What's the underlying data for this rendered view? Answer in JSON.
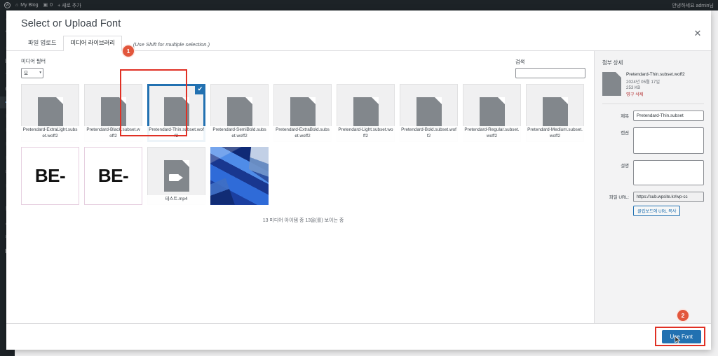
{
  "adminbar": {
    "logo_icon": "wordpress-logo-icon",
    "home_icon": "home-icon",
    "site_name": "My Blog",
    "comments_icon": "comment-bubble-icon",
    "comments_count": "0",
    "new_label": "+ 새로 추가",
    "howdy": "안녕하세요 admin님"
  },
  "adminmenu": {
    "items": [
      {
        "icon": "dashboard-icon",
        "state": "normal"
      },
      {
        "icon": "pin-posts-icon",
        "state": "normal"
      },
      {
        "icon": "media-icon",
        "state": "normal"
      },
      {
        "icon": "page-icon",
        "state": "normal"
      },
      {
        "icon": "comments-icon",
        "state": "normal"
      },
      {
        "icon": "appearance-icon",
        "state": "normal"
      },
      {
        "icon": "plugins-icon",
        "state": "current"
      },
      {
        "icon": "users-icon",
        "state": "faint"
      },
      {
        "icon": "tools-icon",
        "state": "faint"
      },
      {
        "icon": "settings-icon",
        "state": "faint"
      },
      {
        "icon": "collapse-icon",
        "state": "faint"
      }
    ]
  },
  "modal": {
    "title": "Select or Upload Font",
    "close_icon": "close-icon",
    "tabs": [
      {
        "label": "파일 업로드",
        "active": false
      },
      {
        "label": "미디어 라이브러리",
        "active": true
      }
    ],
    "tab_hint": "(Use Shift for multiple selection.)"
  },
  "toolbar": {
    "filter_label": "미디어 필터",
    "filter_value": "모",
    "filter_caret_icon": "chevron-down-icon",
    "search_label": "검색",
    "search_value": "",
    "search_placeholder": ""
  },
  "grid": {
    "items": [
      {
        "type": "document",
        "label": "Pretendard-ExtraLight.subset.woff2",
        "icon": "document-file-icon",
        "selected": false
      },
      {
        "type": "document",
        "label": "Pretendard-Black.subset.woff2",
        "icon": "document-file-icon",
        "selected": false
      },
      {
        "type": "document",
        "label": "Pretendard-Thin.subset.woff2",
        "icon": "document-file-icon",
        "selected": true
      },
      {
        "type": "document",
        "label": "Pretendard-SemiBold.subset.woff2",
        "icon": "document-file-icon",
        "selected": false
      },
      {
        "type": "document",
        "label": "Pretendard-ExtraBold.subset.woff2",
        "icon": "document-file-icon",
        "selected": false
      },
      {
        "type": "document",
        "label": "Pretendard-Light.subset.woff2",
        "icon": "document-file-icon",
        "selected": false
      },
      {
        "type": "document",
        "label": "Pretendard-Bold.subset.woff2",
        "icon": "document-file-icon",
        "selected": false
      },
      {
        "type": "document",
        "label": "Pretendard-Regular.subset.woff2",
        "icon": "document-file-icon",
        "selected": false
      },
      {
        "type": "document",
        "label": "Pretendard-Medium.subset.woff2",
        "icon": "document-file-icon",
        "selected": false
      },
      {
        "type": "image-text",
        "label": "",
        "art": "BE-",
        "icon": "image-thumbnail-icon",
        "selected": false
      },
      {
        "type": "image-text",
        "label": "",
        "art": "BE-",
        "icon": "image-thumbnail-icon",
        "selected": false
      },
      {
        "type": "video",
        "label": "테스트.mp4",
        "icon": "video-file-icon",
        "selected": false
      },
      {
        "type": "photo",
        "label": "",
        "icon": "photo-thumbnail-icon",
        "selected": false
      }
    ],
    "check_icon": "checkmark-icon",
    "count_text": "13 미디어 아이템 중 13을(를) 보이는 중"
  },
  "sidebar": {
    "heading": "첨부 상세",
    "thumb_icon": "document-file-icon",
    "filename": "Pretendard-Thin.subset.woff2",
    "date": "2024년 05월 17일",
    "filesize": "253 KB",
    "delete_label": "영구 삭제",
    "fields": {
      "title_label": "제목",
      "title_value": "Pretendard-Thin.subset",
      "caption_label": "캡션",
      "caption_value": "",
      "description_label": "설명",
      "description_value": "",
      "url_label": "파일 URL:",
      "url_value": "https://sub.wpsite.kr/wp-cc",
      "copy_button": "클립보드에 URL 복사"
    }
  },
  "footer": {
    "use_font_label": "Use Font"
  },
  "annotations": [
    {
      "number": "1",
      "target": "selected-media-tile"
    },
    {
      "number": "2",
      "target": "use-font-button"
    }
  ],
  "colors": {
    "accent_blue": "#2271b1",
    "annotation_red": "#e03024",
    "badge_orange": "#e2563c",
    "delete_red": "#b32d2e",
    "admin_dark": "#1d2327"
  }
}
